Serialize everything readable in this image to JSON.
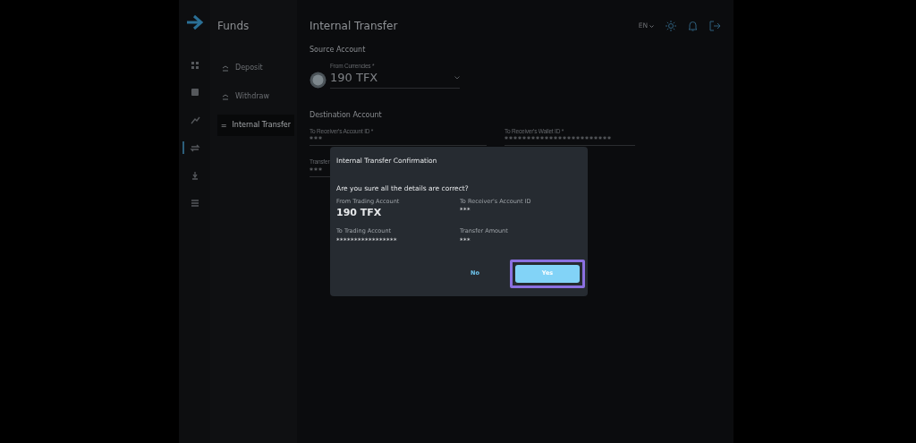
{
  "rail": {
    "items": [
      {
        "selected": false
      },
      {
        "selected": false
      },
      {
        "selected": false
      },
      {
        "selected": true
      },
      {
        "selected": false
      },
      {
        "selected": false
      }
    ]
  },
  "sidebar": {
    "title": "Funds",
    "items": [
      {
        "label": "Deposit",
        "selected": false
      },
      {
        "label": "Withdraw",
        "selected": false
      },
      {
        "label": "Internal Transfer",
        "selected": true
      }
    ]
  },
  "header": {
    "title": "Internal Transfer",
    "language": "EN"
  },
  "source": {
    "heading": "Source Account",
    "field": {
      "label": "From Currencies *",
      "value": "190 TFX"
    }
  },
  "destination": {
    "heading": "Destination Account",
    "fields": [
      {
        "label": "To Receiver's Account ID *",
        "value": "***"
      },
      {
        "label": "To Receiver's Wallet ID *",
        "value": "************************"
      },
      {
        "label": "Transfer",
        "value": "***"
      }
    ]
  },
  "dialog": {
    "title": "Internal Transfer Confirmation",
    "question": "Are you sure all the details are correct?",
    "details": [
      {
        "label": "From Trading Account",
        "value": "190 TFX",
        "emphasis": true
      },
      {
        "label": "To Receiver's Account ID",
        "value": "***",
        "emphasis": false
      },
      {
        "label": "To Trading Account",
        "value": "*****************",
        "emphasis": false
      },
      {
        "label": "Transfer Amount",
        "value": "***",
        "emphasis": false
      }
    ],
    "buttons": [
      {
        "label": "No",
        "kind": "text",
        "focused": false
      },
      {
        "label": "Yes",
        "kind": "primary",
        "focused": true
      }
    ]
  }
}
